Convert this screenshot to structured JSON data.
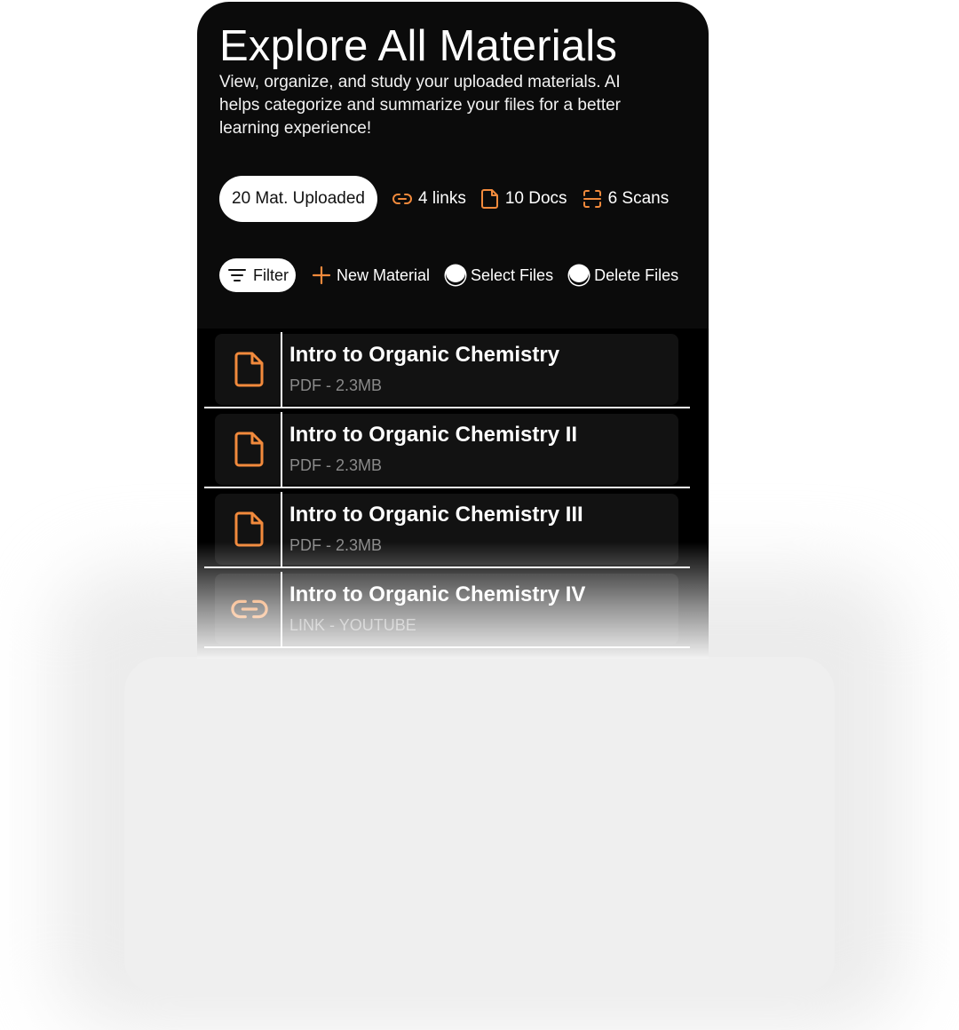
{
  "header": {
    "title": "Explore All Materials",
    "subtitle": "View, organize, and study your uploaded materials. AI helps categorize and summarize your files for a better learning experience!"
  },
  "stats": {
    "uploaded": "20 Mat. Uploaded",
    "links": "4 links",
    "docs": "10 Docs",
    "scans": "6 Scans"
  },
  "actions": {
    "filter": "Filter",
    "new_material": "New Material",
    "select_files": "Select Files",
    "delete_files": "Delete Files"
  },
  "materials": [
    {
      "title": "Intro to Organic Chemistry",
      "meta": "PDF - 2.3MB",
      "icon": "document-icon"
    },
    {
      "title": "Intro to Organic Chemistry II",
      "meta": "PDF - 2.3MB",
      "icon": "document-icon"
    },
    {
      "title": "Intro to Organic Chemistry III",
      "meta": "PDF - 2.3MB",
      "icon": "document-icon"
    },
    {
      "title": "Intro to Organic Chemistry IV",
      "meta": "LINK - YOUTUBE",
      "icon": "link-icon"
    }
  ],
  "colors": {
    "accent": "#F28A3C",
    "background": "#0B0B0B",
    "card": "#121212",
    "text": "#FFFFFF",
    "muted": "#8A8A8A"
  }
}
